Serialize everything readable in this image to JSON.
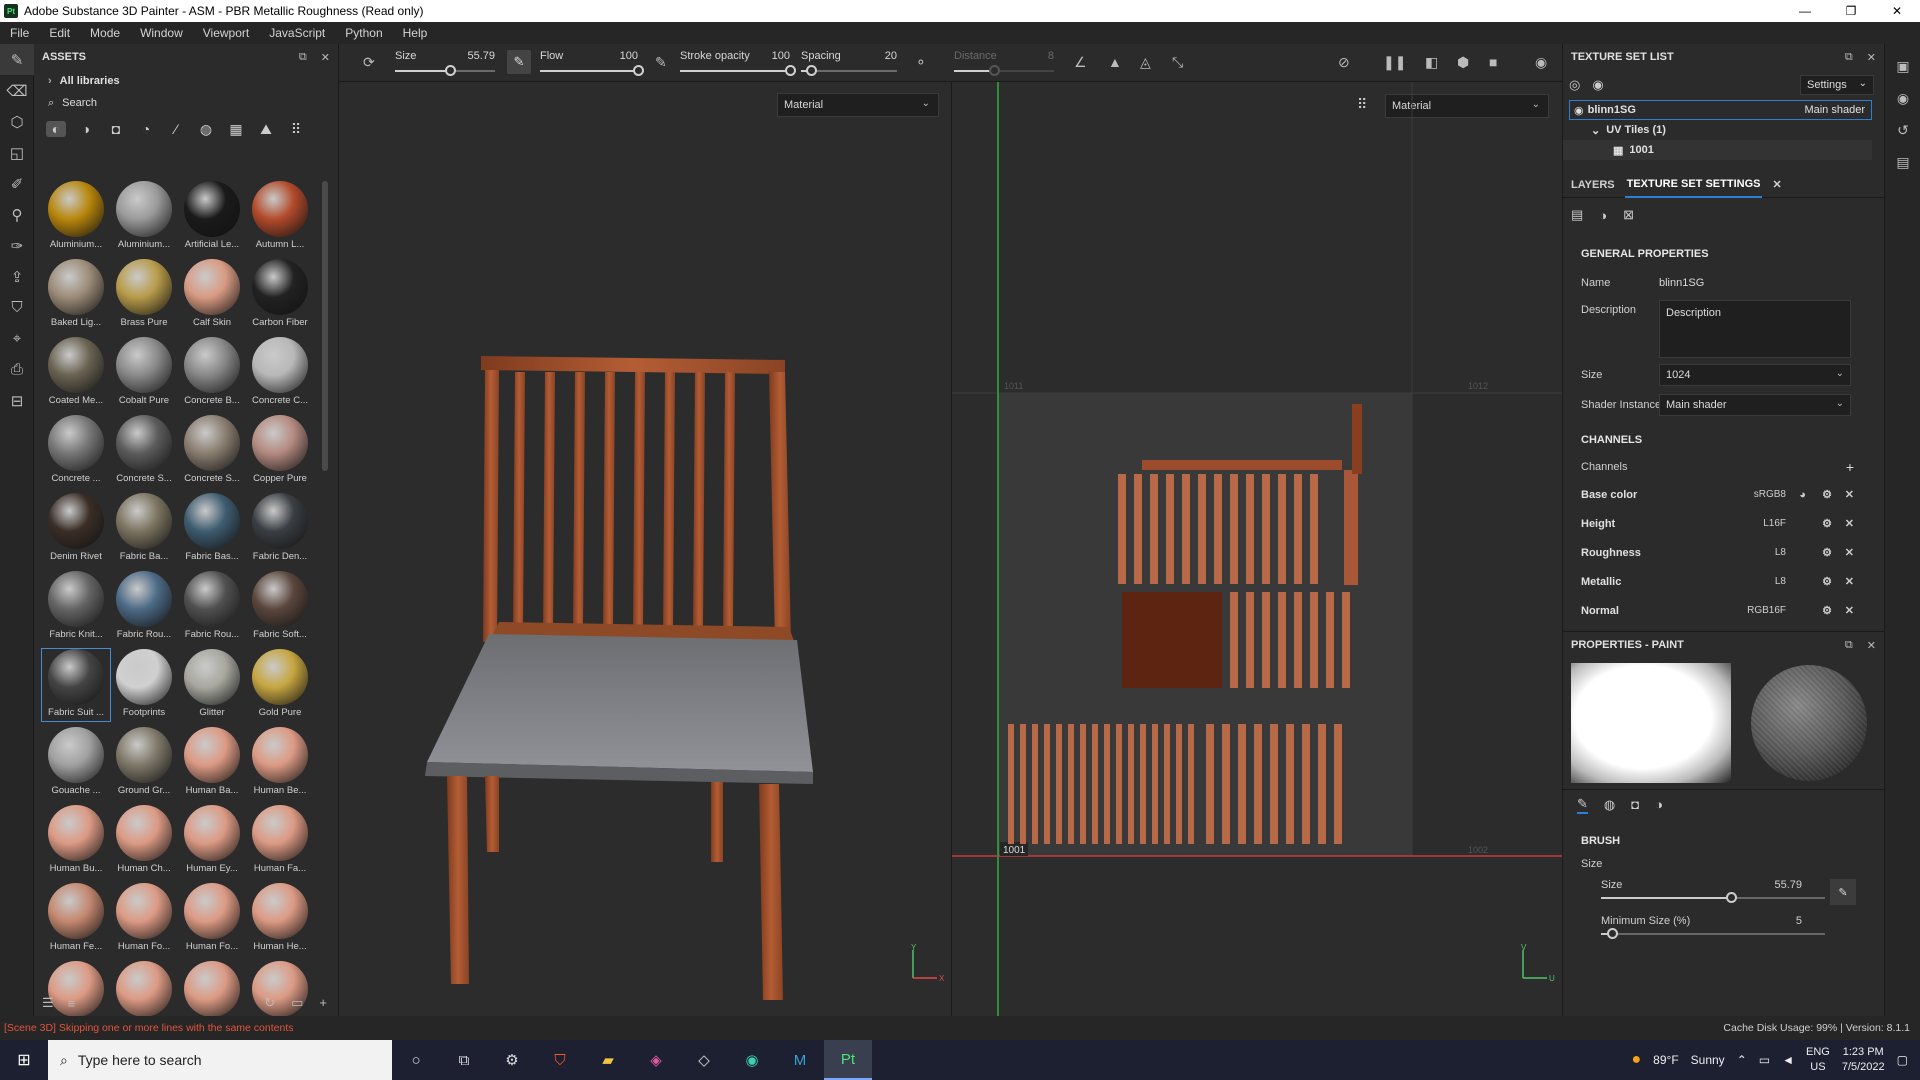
{
  "window": {
    "app_icon": "Pt",
    "title": "Adobe Substance 3D Painter - ASM - PBR Metallic Roughness (Read only)",
    "minimize": "—",
    "maximize": "❐",
    "close": "✕"
  },
  "menu": [
    "File",
    "Edit",
    "Mode",
    "Window",
    "Viewport",
    "JavaScript",
    "Python",
    "Help"
  ],
  "assets": {
    "title": "ASSETS",
    "library": "All libraries",
    "search_placeholder": "Search",
    "items": [
      {
        "label": "Aluminium...",
        "color": "#b8860b"
      },
      {
        "label": "Aluminium...",
        "color": "#9a9a9a"
      },
      {
        "label": "Artificial Le...",
        "color": "#1a1a1a"
      },
      {
        "label": "Autumn L...",
        "color": "#b24a2a"
      },
      {
        "label": "Baked Lig...",
        "color": "#9c8c78"
      },
      {
        "label": "Brass Pure",
        "color": "#b89b4a"
      },
      {
        "label": "Calf Skin",
        "color": "#d89a82"
      },
      {
        "label": "Carbon Fiber",
        "color": "#222222"
      },
      {
        "label": "Coated Me...",
        "color": "#6a6352"
      },
      {
        "label": "Cobalt Pure",
        "color": "#8a8a8a"
      },
      {
        "label": "Concrete B...",
        "color": "#888888"
      },
      {
        "label": "Concrete C...",
        "color": "#b8b8b8"
      },
      {
        "label": "Concrete ...",
        "color": "#777777"
      },
      {
        "label": "Concrete S...",
        "color": "#5c5c5c"
      },
      {
        "label": "Concrete S...",
        "color": "#8a7e70"
      },
      {
        "label": "Copper Pure",
        "color": "#b48a80"
      },
      {
        "label": "Denim Rivet",
        "color": "#3a2e26"
      },
      {
        "label": "Fabric Ba...",
        "color": "#7c7460"
      },
      {
        "label": "Fabric Bas...",
        "color": "#3e5c70"
      },
      {
        "label": "Fabric Den...",
        "color": "#3a3e42"
      },
      {
        "label": "Fabric Knit...",
        "color": "#646464"
      },
      {
        "label": "Fabric Rou...",
        "color": "#4c6a86"
      },
      {
        "label": "Fabric Rou...",
        "color": "#505050"
      },
      {
        "label": "Fabric Soft...",
        "color": "#5a463c"
      },
      {
        "label": "Fabric Suit ...",
        "color": "#444444"
      },
      {
        "label": "Footprints",
        "color": "#d0d0d0"
      },
      {
        "label": "Glitter",
        "color": "#a8a8a0"
      },
      {
        "label": "Gold Pure",
        "color": "#c6a640"
      },
      {
        "label": "Gouache ...",
        "color": "#a0a0a0"
      },
      {
        "label": "Ground Gr...",
        "color": "#7e7868"
      },
      {
        "label": "Human Ba...",
        "color": "#dc9a84"
      },
      {
        "label": "Human Be...",
        "color": "#dc9a84"
      },
      {
        "label": "Human Bu...",
        "color": "#dc9a84"
      },
      {
        "label": "Human Ch...",
        "color": "#dc9a84"
      },
      {
        "label": "Human Ey...",
        "color": "#dc9a84"
      },
      {
        "label": "Human Fa...",
        "color": "#dc9a84"
      },
      {
        "label": "Human Fe...",
        "color": "#c48870"
      },
      {
        "label": "Human Fo...",
        "color": "#dc9a84"
      },
      {
        "label": "Human Fo...",
        "color": "#dc9a84"
      },
      {
        "label": "Human He...",
        "color": "#dc9a84"
      },
      {
        "label": "",
        "color": "#dc9a84"
      },
      {
        "label": "",
        "color": "#dc9a84"
      },
      {
        "label": "",
        "color": "#dc9a84"
      },
      {
        "label": "",
        "color": "#dc9a84"
      }
    ]
  },
  "toolbar": {
    "size_label": "Size",
    "size_value": "55.79",
    "size_level": 0.55,
    "flow_label": "Flow",
    "flow_value": "100",
    "flow_level": 1.0,
    "opacity_label": "Stroke opacity",
    "opacity_value": "100",
    "opacity_level": 1.0,
    "spacing_label": "Spacing",
    "spacing_value": "20",
    "spacing_level": 0.1,
    "distance_label": "Distance",
    "distance_value": "8",
    "distance_level": 0.4
  },
  "viewport": {
    "material_3d": "Material",
    "material_2d": "Material",
    "uv_1001": "1001",
    "uv_1011": "1011",
    "uv_1012": "1012",
    "uv_1002": "1002",
    "axis_y": "Y",
    "axis_x": "X",
    "axis_u": "U",
    "axis_v": "V"
  },
  "texture_set_list": {
    "title": "TEXTURE SET LIST",
    "settings": "Settings",
    "set_name": "blinn1SG",
    "shader": "Main shader",
    "uv_tiles": "UV Tiles (1)",
    "tile": "1001"
  },
  "tabs": {
    "layers": "LAYERS",
    "tss": "TEXTURE SET SETTINGS"
  },
  "general": {
    "title": "GENERAL PROPERTIES",
    "name_label": "Name",
    "name_value": "blinn1SG",
    "desc_label": "Description",
    "desc_value": "Description",
    "size_label": "Size",
    "size_value": "1024",
    "shader_label": "Shader Instance",
    "shader_value": "Main shader"
  },
  "channels": {
    "title": "CHANNELS",
    "label": "Channels",
    "items": [
      {
        "name": "Base color",
        "format": "sRGB8"
      },
      {
        "name": "Height",
        "format": "L16F"
      },
      {
        "name": "Roughness",
        "format": "L8"
      },
      {
        "name": "Metallic",
        "format": "L8"
      },
      {
        "name": "Normal",
        "format": "RGB16F"
      }
    ]
  },
  "properties": {
    "title": "PROPERTIES - PAINT",
    "brush_title": "BRUSH",
    "size_section": "Size",
    "size_label": "Size",
    "size_value": "55.79",
    "size_level": 0.58,
    "minsize_label": "Minimum Size (%)",
    "minsize_value": "5",
    "minsize_level": 0.05
  },
  "status": {
    "message": "[Scene 3D] Skipping one or more lines with the same contents",
    "cache": "Cache Disk Usage:   99% | Version: 8.1.1"
  },
  "taskbar": {
    "search": "Type here to search",
    "weather_temp": "89°F",
    "weather_text": "Sunny",
    "lang1": "ENG",
    "lang2": "US",
    "time": "1:23 PM",
    "date": "7/5/2022"
  }
}
